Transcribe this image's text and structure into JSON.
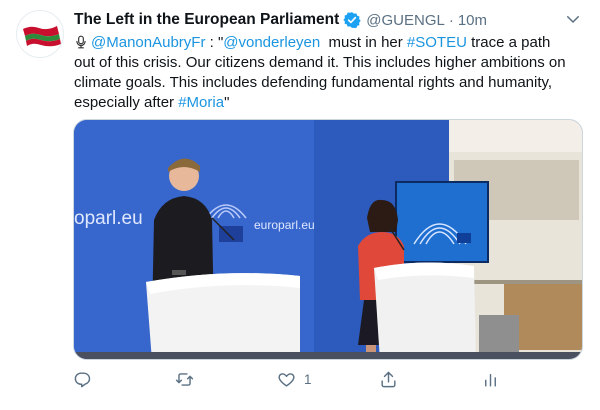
{
  "tweet": {
    "author_name": "The Left in the European Parliament",
    "author_handle": "@GUENGL",
    "separator": "·",
    "time": "10m",
    "text": {
      "line1_mention1": "@ManonAubryFr",
      "line1_mid": " : \"",
      "line1_mention2": "@vonderleyen",
      "line1_text": "  must in her ",
      "line1_hashtag": "#SOTEU",
      "line1_end": " trace a path",
      "line2": "out of this crisis. Our citizens demand it. This includes higher ambitions on",
      "line3": "climate goals. This includes defending fundamental rights and humanity,",
      "line4_start": "especially after ",
      "line4_hashtag": "#Moria",
      "line4_end": "\""
    },
    "media": {
      "backdrop_text_left": "oparl.eu",
      "backdrop_text_right": "europarl.eu"
    },
    "actions": {
      "reply_count": "",
      "retweet_count": "",
      "like_count": "1",
      "share_count": ""
    },
    "colors": {
      "link": "#1b95e0",
      "secondary": "#5b7083",
      "verified": "#1da1f2"
    }
  }
}
